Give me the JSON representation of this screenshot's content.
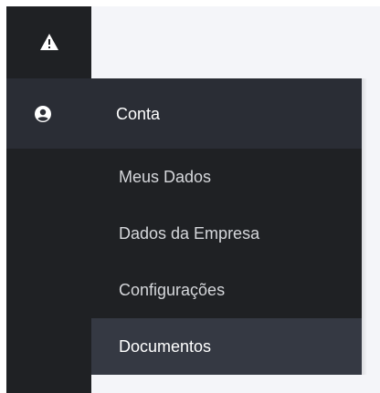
{
  "sidebar": {
    "top_icon": "warning-icon",
    "account_icon": "user-circle-icon"
  },
  "menu": {
    "account_label": "Conta",
    "items": [
      {
        "label": "Meus Dados",
        "active": false
      },
      {
        "label": "Dados da Empresa",
        "active": false
      },
      {
        "label": "Configurações",
        "active": false
      },
      {
        "label": "Documentos",
        "active": true
      }
    ]
  },
  "colors": {
    "sidebar_bg": "#1f2124",
    "menu_header_bg": "#2a2d35",
    "active_item_bg": "#353943",
    "content_bg": "#f4f5f9",
    "text_primary": "#ffffff",
    "text_secondary": "#d5d7db"
  }
}
